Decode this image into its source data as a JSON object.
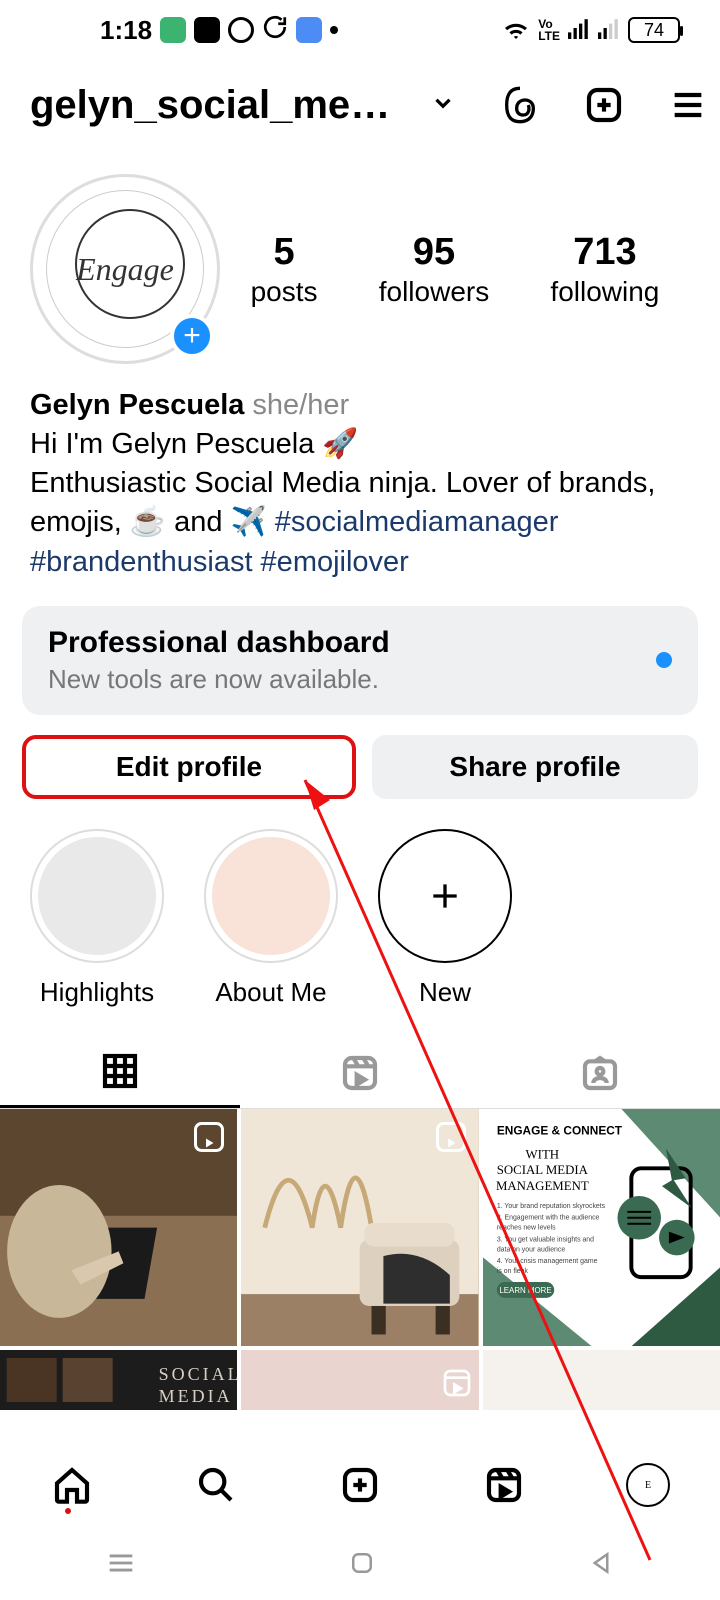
{
  "statusbar": {
    "time": "1:18",
    "battery": "74"
  },
  "header": {
    "username": "gelyn_social_medi…"
  },
  "stats": {
    "posts": {
      "count": "5",
      "label": "posts"
    },
    "followers": {
      "count": "95",
      "label": "followers"
    },
    "following": {
      "count": "713",
      "label": "following"
    }
  },
  "bio": {
    "name": "Gelyn Pescuela",
    "pronouns": "she/her",
    "line1": "Hi I'm Gelyn Pescuela 🚀",
    "line2": "Enthusiastic Social Media ninja. Lover of brands, emojis, ☕ and ✈️ ",
    "hashtags": "#socialmediamanager #brandenthusiast #emojilover"
  },
  "dashboard": {
    "title": "Professional dashboard",
    "subtitle": "New tools are now available."
  },
  "buttons": {
    "edit": "Edit profile",
    "share": "Share profile"
  },
  "highlights": {
    "h1": "Highlights",
    "h2": "About Me",
    "new": "New"
  },
  "post3": {
    "brand": "ENGAGE & CONNECT",
    "title1": "WITH",
    "title2": "SOCIAL MEDIA",
    "title3": "MANAGEMENT",
    "cta": "LEARN MORE"
  },
  "post4": {
    "t1": "SOCIAL",
    "t2": "MEDIA"
  }
}
